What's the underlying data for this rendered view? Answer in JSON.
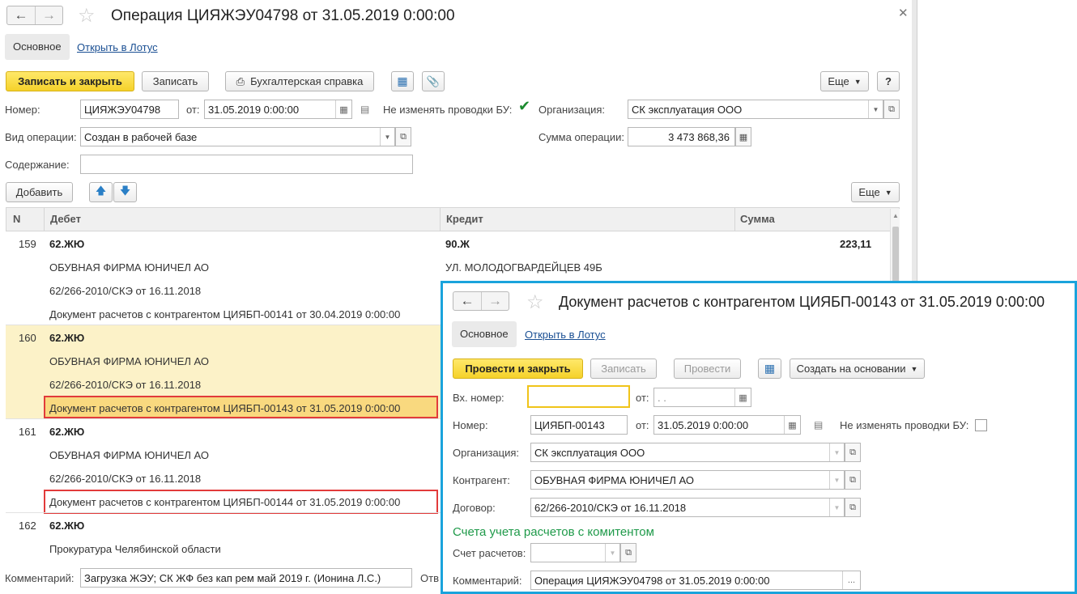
{
  "main": {
    "title": "Операция ЦИЯЖЭУ04798 от 31.05.2019 0:00:00",
    "tab_main": "Основное",
    "tab_lotus": "Открыть в Лотус",
    "btn_save_close": "Записать и закрыть",
    "btn_save": "Записать",
    "btn_report": "Бухгалтерская справка",
    "btn_more": "Еще",
    "btn_help": "?",
    "lbl_number": "Номер:",
    "number": "ЦИЯЖЭУ04798",
    "lbl_from": "от:",
    "date": "31.05.2019  0:00:00",
    "lbl_no_change": "Не изменять проводки БУ:",
    "lbl_org": "Организация:",
    "org": "СК эксплуатация ООО",
    "lbl_op_type": "Вид операции:",
    "op_type": "Создан в рабочей базе",
    "lbl_sum": "Сумма операции:",
    "sum": "3 473 868,36",
    "lbl_content": "Содержание:",
    "content": "",
    "btn_add": "Добавить",
    "btn_more2": "Еще",
    "grid_headers": {
      "n": "N",
      "debit": "Дебет",
      "credit": "Кредит",
      "sum": "Сумма"
    },
    "rows": [
      {
        "n": "159",
        "debit": [
          "62.ЖЮ",
          "ОБУВНАЯ ФИРМА ЮНИЧЕЛ АО",
          "62/266-2010/СКЭ от 16.11.2018",
          "Документ расчетов с контрагентом ЦИЯБП-00141 от 30.04.2019 0:00:00"
        ],
        "credit": [
          "90.Ж",
          "УЛ. МОЛОДОГВАРДЕЙЦЕВ 49Б"
        ],
        "sum": "223,11"
      },
      {
        "n": "160",
        "debit": [
          "62.ЖЮ",
          "ОБУВНАЯ ФИРМА ЮНИЧЕЛ АО",
          "62/266-2010/СКЭ от 16.11.2018",
          "Документ расчетов с контрагентом ЦИЯБП-00143 от 31.05.2019 0:00:00"
        ]
      },
      {
        "n": "161",
        "debit": [
          "62.ЖЮ",
          "ОБУВНАЯ ФИРМА ЮНИЧЕЛ АО",
          "62/266-2010/СКЭ от 16.11.2018",
          "Документ расчетов с контрагентом ЦИЯБП-00144 от 31.05.2019 0:00:00"
        ]
      },
      {
        "n": "162",
        "debit": [
          "62.ЖЮ",
          "Прокуратура Челябинской области"
        ]
      }
    ],
    "lbl_comment": "Комментарий:",
    "comment": "Загрузка ЖЭУ; СК ЖФ без кап рем  май   2019 г. (Ионина Л.С.)",
    "lbl_resp": "Отв"
  },
  "sub": {
    "title": "Документ расчетов с контрагентом ЦИЯБП-00143 от 31.05.2019 0:00:00",
    "tab_main": "Основное",
    "tab_lotus": "Открыть в Лотус",
    "btn_post_close": "Провести и закрыть",
    "btn_save": "Записать",
    "btn_post": "Провести",
    "btn_create_based": "Создать на основании",
    "lbl_in_number": "Вх. номер:",
    "in_number": "",
    "lbl_from": "от:",
    "in_date": " .  .",
    "lbl_number": "Номер:",
    "number": "ЦИЯБП-00143",
    "date": "31.05.2019  0:00:00",
    "lbl_no_change": "Не изменять проводки БУ:",
    "lbl_org": "Организация:",
    "org": "СК эксплуатация ООО",
    "lbl_contractor": "Контрагент:",
    "contractor": "ОБУВНАЯ ФИРМА ЮНИЧЕЛ АО",
    "lbl_contract": "Договор:",
    "contract": "62/266-2010/СКЭ от 16.11.2018",
    "section_accounts": "Счета учета расчетов с комитентом",
    "lbl_account": "Счет расчетов:",
    "account": "",
    "lbl_comment": "Комментарий:",
    "comment": "Операция ЦИЯЖЭУ04798 от 31.05.2019 0:00:00",
    "comment_btn": "..."
  }
}
